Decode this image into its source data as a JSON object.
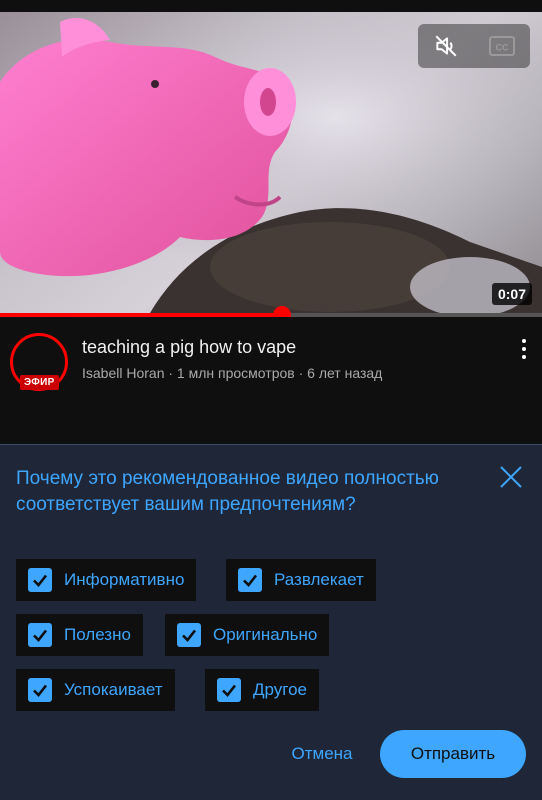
{
  "video": {
    "duration": "0:07",
    "progress_percent": 52,
    "controls": {
      "mute_icon": "volume-off-icon",
      "captions_icon": "captions-icon",
      "captions_label": "CC"
    }
  },
  "channel": {
    "live_badge": "ЭФИР"
  },
  "info": {
    "title": "teaching a pig how to vape",
    "meta": "Isabell Horan · 1 млн просмотров · 6 лет назад"
  },
  "feedback": {
    "question": "Почему это рекомендованное видео полностью соответствует вашим предпочтениям?",
    "options": [
      {
        "label": "Информативно",
        "checked": true
      },
      {
        "label": "Развлекает",
        "checked": true
      },
      {
        "label": "Полезно",
        "checked": true
      },
      {
        "label": "Оригинально",
        "checked": true
      },
      {
        "label": "Успокаивает",
        "checked": true
      },
      {
        "label": "Другое",
        "checked": true
      }
    ],
    "cancel_label": "Отмена",
    "submit_label": "Отправить"
  },
  "colors": {
    "accent": "#3ea6ff",
    "progress": "#ff0000",
    "panel_bg": "#1e2637",
    "chip_bg": "#0f0f0f"
  }
}
